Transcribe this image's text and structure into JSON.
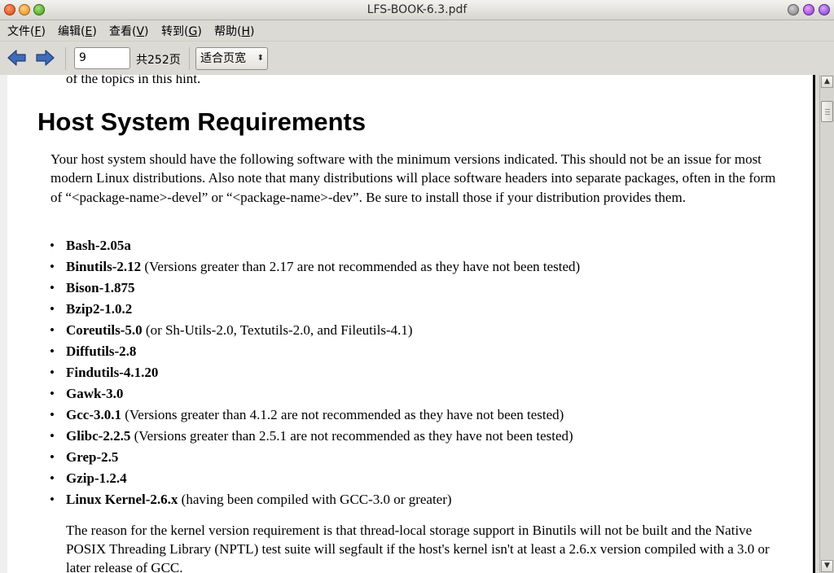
{
  "window": {
    "title": "LFS-BOOK-6.3.pdf"
  },
  "menu": [
    {
      "label": "文件(",
      "key": "F",
      "end": ")"
    },
    {
      "label": "编辑(",
      "key": "E",
      "end": ")"
    },
    {
      "label": "查看(",
      "key": "V",
      "end": ")"
    },
    {
      "label": "转到(",
      "key": "G",
      "end": ")"
    },
    {
      "label": "帮助(",
      "key": "H",
      "end": ")"
    }
  ],
  "toolbar": {
    "back_icon": "back-arrow-icon",
    "forward_icon": "forward-arrow-icon",
    "page_value": "9",
    "page_total": "共252页",
    "zoom_value": "适合页宽",
    "accent": "#3f6cb5"
  },
  "document": {
    "previous_line": "of the topics in this hint.",
    "heading": "Host System Requirements",
    "intro": "Your host system should have the following software with the minimum versions indicated. This should not be an issue for most modern Linux distributions. Also note that many distributions will place software headers into separate packages, often in the form of “<package-name>-devel” or “<package-name>-dev”. Be sure to install those if your distribution provides them.",
    "requirements": [
      {
        "name": "Bash-2.05a",
        "note": ""
      },
      {
        "name": "Binutils-2.12",
        "note": "(Versions greater than 2.17 are not recommended as they have not been tested)"
      },
      {
        "name": "Bison-1.875",
        "note": ""
      },
      {
        "name": "Bzip2-1.0.2",
        "note": ""
      },
      {
        "name": "Coreutils-5.0",
        "note": "(or Sh-Utils-2.0, Textutils-2.0, and Fileutils-4.1)"
      },
      {
        "name": "Diffutils-2.8",
        "note": ""
      },
      {
        "name": "Findutils-4.1.20",
        "note": ""
      },
      {
        "name": "Gawk-3.0",
        "note": ""
      },
      {
        "name": "Gcc-3.0.1",
        "note": "(Versions greater than 4.1.2 are not recommended as they have not been tested)"
      },
      {
        "name": "Glibc-2.2.5",
        "note": "(Versions greater than 2.5.1 are not recommended as they have not been tested)"
      },
      {
        "name": "Grep-2.5",
        "note": ""
      },
      {
        "name": "Gzip-1.2.4",
        "note": ""
      },
      {
        "name": "Linux Kernel-2.6.x",
        "note": "(having been compiled with GCC-3.0 or greater)"
      }
    ],
    "reason": "The reason for the kernel version requirement is that thread-local storage support in Binutils will not be built and the Native POSIX Threading Library (NPTL) test suite will segfault if the host's kernel isn't at least a 2.6.x version compiled with a 3.0 or later release of GCC."
  }
}
